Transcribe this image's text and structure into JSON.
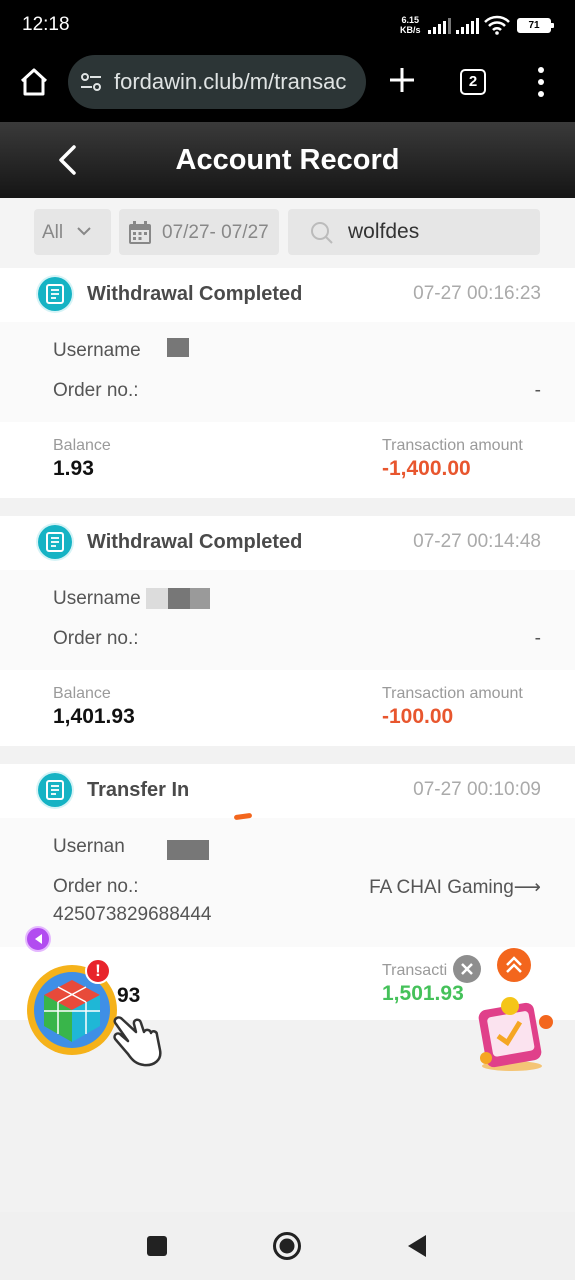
{
  "status_bar": {
    "time": "12:18",
    "net_speed_value": "6.15",
    "net_speed_unit": "KB/s",
    "battery": "71"
  },
  "browser": {
    "url": "fordawin.club/m/transac",
    "tab_count": "2"
  },
  "header": {
    "title": "Account Record"
  },
  "filters": {
    "type": "All",
    "date_range": "07/27- 07/27",
    "search_value": "wolfdes"
  },
  "records": [
    {
      "title": "Withdrawal Completed",
      "time": "07-27 00:16:23",
      "username_label": "Username",
      "order_label": "Order no.:",
      "order_value": "-",
      "balance_label": "Balance",
      "balance": "1.93",
      "amount_label": "Transaction amount",
      "amount": "-1,400.00"
    },
    {
      "title": "Withdrawal Completed",
      "time": "07-27 00:14:48",
      "username_label": "Username",
      "order_label": "Order no.:",
      "order_value": "-",
      "balance_label": "Balance",
      "balance": "1,401.93",
      "amount_label": "Transaction amount",
      "amount": "-100.00"
    },
    {
      "title": "Transfer In",
      "time": "07-27 00:10:09",
      "username_label": "Usernan",
      "order_label": "Order no.:",
      "order_value": "FA CHAI Gaming⟶",
      "order_number": "425073829688444",
      "balance_partial": "93",
      "amount_label": "Transacti",
      "amount": "1,501.93"
    }
  ],
  "floating": {
    "alert_badge": "!"
  },
  "colors": {
    "negative": "#e8562e",
    "positive": "#45c15a",
    "record_icon": "#15b3c4",
    "header_bg": "#2a2a2a"
  }
}
